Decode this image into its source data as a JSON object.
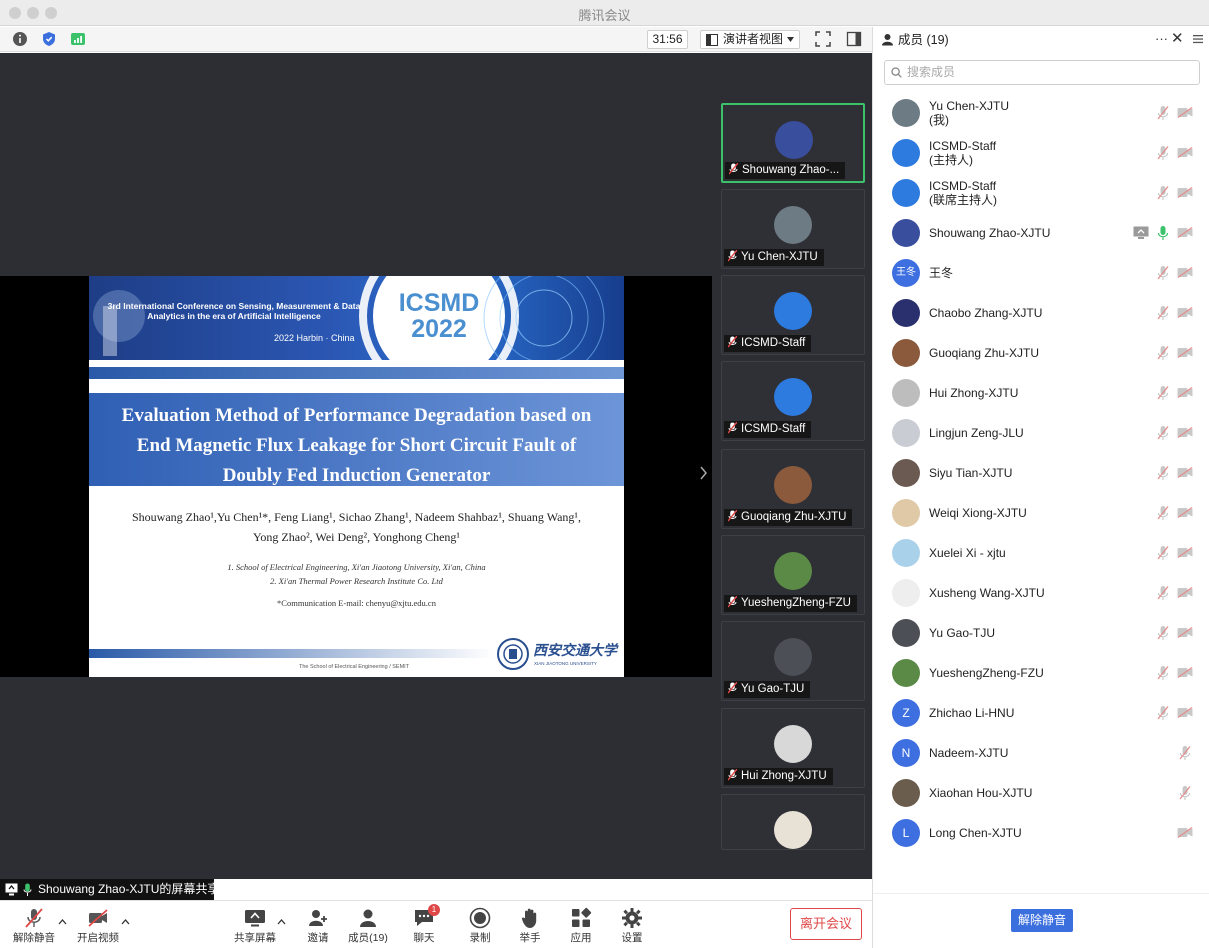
{
  "window": {
    "title": "腾讯会议"
  },
  "toolbar": {
    "timer": "31:56",
    "view_mode": "演讲者视图"
  },
  "slide": {
    "conference": "3rd International Conference on Sensing, Measurement & Data Analytics in the era of Artificial Intelligence",
    "location": "2022 Harbin · China",
    "logo_acronym": "ICSMD",
    "logo_year": "2022",
    "title_line1": "Evaluation Method of Performance Degradation based on",
    "title_line2": "End Magnetic Flux Leakage for Short Circuit Fault of",
    "title_line3": "Doubly Fed Induction Generator",
    "authors_line1": "Shouwang Zhao¹,Yu Chen¹*, Feng Liang¹, Sichao Zhang¹, Nadeem Shahbaz¹, Shuang Wang¹,",
    "authors_line2": "Yong Zhao², Wei Deng², Yonghong Cheng¹",
    "affil1": "1. School of Electrical Engineering, Xi'an Jiaotong University, Xi'an, China",
    "affil2": "2. Xi'an Thermal Power Research Institute Co. Ltd",
    "email": "*Communication E-mail: chenyu@xjtu.edu.cn",
    "footer": "The School of Electrical Engineering / SEMIT",
    "university_cn": "西安交通大学",
    "university_en": "XIAN JIAOTONG UNIVERSITY"
  },
  "thumbnails": [
    {
      "label": "Shouwang Zhao-...",
      "avatar_color": "#3a4e9e"
    },
    {
      "label": "Yu Chen-XJTU",
      "avatar_color": "#6d7b84"
    },
    {
      "label": "ICSMD-Staff",
      "avatar_color": "#2e7be0"
    },
    {
      "label": "ICSMD-Staff",
      "avatar_color": "#2e7be0"
    },
    {
      "label": "Guoqiang Zhu-XJTU",
      "avatar_color": "#8b5a3c"
    },
    {
      "label": "YueshengZheng-FZU",
      "avatar_color": "#5b8a47"
    },
    {
      "label": "Yu Gao-TJU",
      "avatar_color": "#4c4f55"
    },
    {
      "label": "Hui Zhong-XJTU",
      "avatar_color": "#d8d8d8"
    },
    {
      "label": "",
      "avatar_color": "#e8e1d6"
    }
  ],
  "share_banner": "Shouwang Zhao-XJTU的屏幕共享",
  "bottom": {
    "unmute": "解除静音",
    "video": "开启视频",
    "share": "共享屏幕",
    "invite": "邀请",
    "members": "成员(19)",
    "chat": "聊天",
    "chat_badge": "1",
    "record": "录制",
    "raise_hand": "举手",
    "apps": "应用",
    "settings": "设置",
    "leave": "离开会议"
  },
  "panel": {
    "title": "成员 (19)",
    "search_placeholder": "搜索成员",
    "unmute_button": "解除静音",
    "members": [
      {
        "name": "Yu Chen-XJTU",
        "sub": "(我)",
        "avatar_color": "#6d7b84",
        "initial": ""
      },
      {
        "name": "ICSMD-Staff",
        "sub": "(主持人)",
        "avatar_color": "#2e7be0",
        "initial": ""
      },
      {
        "name": "ICSMD-Staff",
        "sub": "(联席主持人)",
        "avatar_color": "#2e7be0",
        "initial": ""
      },
      {
        "name": "Shouwang Zhao-XJTU",
        "sub": "",
        "avatar_color": "#3a4e9e",
        "initial": ""
      },
      {
        "name": "王冬",
        "sub": "",
        "avatar_color": "#3d6fe0",
        "initial": "王冬"
      },
      {
        "name": "Chaobo Zhang-XJTU",
        "sub": "",
        "avatar_color": "#2a2f6e",
        "initial": ""
      },
      {
        "name": "Guoqiang Zhu-XJTU",
        "sub": "",
        "avatar_color": "#8b5a3c",
        "initial": ""
      },
      {
        "name": "Hui Zhong-XJTU",
        "sub": "",
        "avatar_color": "#bdbdbd",
        "initial": ""
      },
      {
        "name": "Lingjun Zeng-JLU",
        "sub": "",
        "avatar_color": "#c9ccd3",
        "initial": ""
      },
      {
        "name": "Siyu Tian-XJTU",
        "sub": "",
        "avatar_color": "#6a5a52",
        "initial": ""
      },
      {
        "name": "Weiqi Xiong-XJTU",
        "sub": "",
        "avatar_color": "#e0c9a6",
        "initial": ""
      },
      {
        "name": "Xuelei Xi - xjtu",
        "sub": "",
        "avatar_color": "#a9d2ea",
        "initial": ""
      },
      {
        "name": "Xusheng Wang-XJTU",
        "sub": "",
        "avatar_color": "#eeeeee",
        "initial": ""
      },
      {
        "name": "Yu Gao-TJU",
        "sub": "",
        "avatar_color": "#4c4f55",
        "initial": ""
      },
      {
        "name": "YueshengZheng-FZU",
        "sub": "",
        "avatar_color": "#5b8a47",
        "initial": ""
      },
      {
        "name": "Zhichao Li-HNU",
        "sub": "",
        "avatar_color": "#3d6fe0",
        "initial": "Z"
      },
      {
        "name": "Nadeem-XJTU",
        "sub": "",
        "avatar_color": "#3d6fe0",
        "initial": "N"
      },
      {
        "name": "Xiaohan Hou-XJTU",
        "sub": "",
        "avatar_color": "#6b5d4d",
        "initial": ""
      },
      {
        "name": "Long Chen-XJTU",
        "sub": "",
        "avatar_color": "#3d6fe0",
        "initial": "L"
      }
    ]
  },
  "colors": {
    "accent": "#3b6fde",
    "danger": "#e04848",
    "active_green": "#3cc26b",
    "stage": "#2d2e33"
  }
}
